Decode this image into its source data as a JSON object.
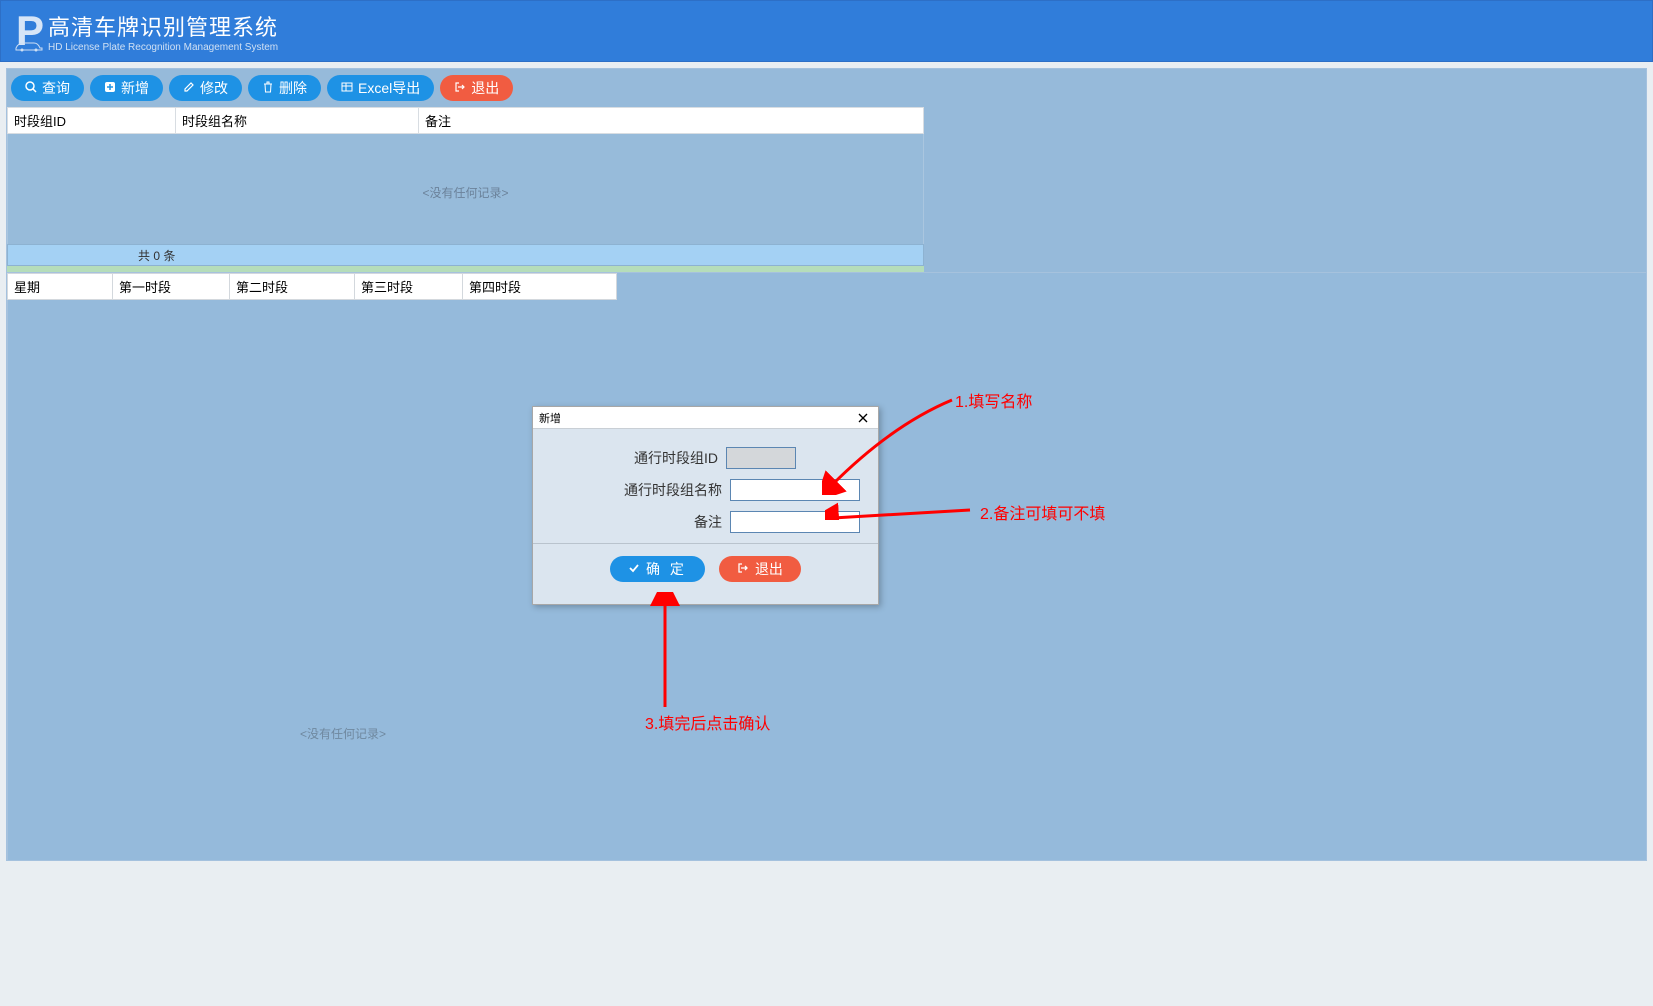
{
  "header": {
    "title_cn": "高清车牌识别管理系统",
    "title_en": "HD License Plate Recognition Management System"
  },
  "toolbar": {
    "query": "查询",
    "add": "新增",
    "edit": "修改",
    "delete": "删除",
    "export": "Excel导出",
    "exit": "退出"
  },
  "grid1": {
    "columns": [
      "时段组ID",
      "时段组名称",
      "备注"
    ],
    "empty": "<没有任何记录>",
    "footer": "共 0 条"
  },
  "grid2": {
    "columns": [
      "星期",
      "第一时段",
      "第二时段",
      "第三时段",
      "第四时段"
    ],
    "empty": "<没有任何记录>"
  },
  "dialog": {
    "title": "新增",
    "fields": {
      "id_label": "通行时段组ID",
      "id_value": "",
      "name_label": "通行时段组名称",
      "name_value": "",
      "remark_label": "备注",
      "remark_value": ""
    },
    "ok": "确 定",
    "exit": "退出"
  },
  "annotations": {
    "a1": "1.填写名称",
    "a2": "2.备注可填可不填",
    "a3": "3.填完后点击确认"
  }
}
